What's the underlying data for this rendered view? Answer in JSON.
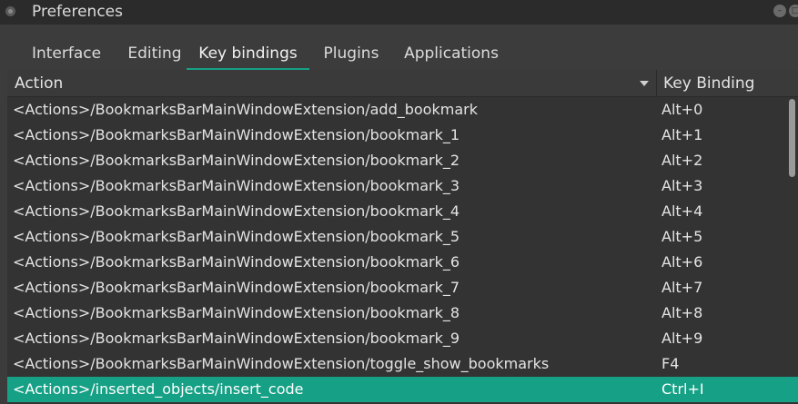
{
  "window": {
    "title": "Preferences"
  },
  "tabs": [
    {
      "label": "Interface"
    },
    {
      "label": "Editing"
    },
    {
      "label": "Key bindings"
    },
    {
      "label": "Plugins"
    },
    {
      "label": "Applications"
    }
  ],
  "active_tab": "Key bindings",
  "table": {
    "columns": {
      "action": "Action",
      "key_binding": "Key Binding"
    },
    "rows": [
      {
        "action": "<Actions>/BookmarksBarMainWindowExtension/add_bookmark",
        "key": "Alt+0"
      },
      {
        "action": "<Actions>/BookmarksBarMainWindowExtension/bookmark_1",
        "key": "Alt+1"
      },
      {
        "action": "<Actions>/BookmarksBarMainWindowExtension/bookmark_2",
        "key": "Alt+2"
      },
      {
        "action": "<Actions>/BookmarksBarMainWindowExtension/bookmark_3",
        "key": "Alt+3"
      },
      {
        "action": "<Actions>/BookmarksBarMainWindowExtension/bookmark_4",
        "key": "Alt+4"
      },
      {
        "action": "<Actions>/BookmarksBarMainWindowExtension/bookmark_5",
        "key": "Alt+5"
      },
      {
        "action": "<Actions>/BookmarksBarMainWindowExtension/bookmark_6",
        "key": "Alt+6"
      },
      {
        "action": "<Actions>/BookmarksBarMainWindowExtension/bookmark_7",
        "key": "Alt+7"
      },
      {
        "action": "<Actions>/BookmarksBarMainWindowExtension/bookmark_8",
        "key": "Alt+8"
      },
      {
        "action": "<Actions>/BookmarksBarMainWindowExtension/bookmark_9",
        "key": "Alt+9"
      },
      {
        "action": "<Actions>/BookmarksBarMainWindowExtension/toggle_show_bookmarks",
        "key": "F4"
      },
      {
        "action": "<Actions>/inserted_objects/insert_code",
        "key": "Ctrl+I",
        "selected": true
      }
    ]
  },
  "colors": {
    "accent": "#16a085",
    "background": "#3c3c3c",
    "titlebar": "#2b2b2b"
  }
}
